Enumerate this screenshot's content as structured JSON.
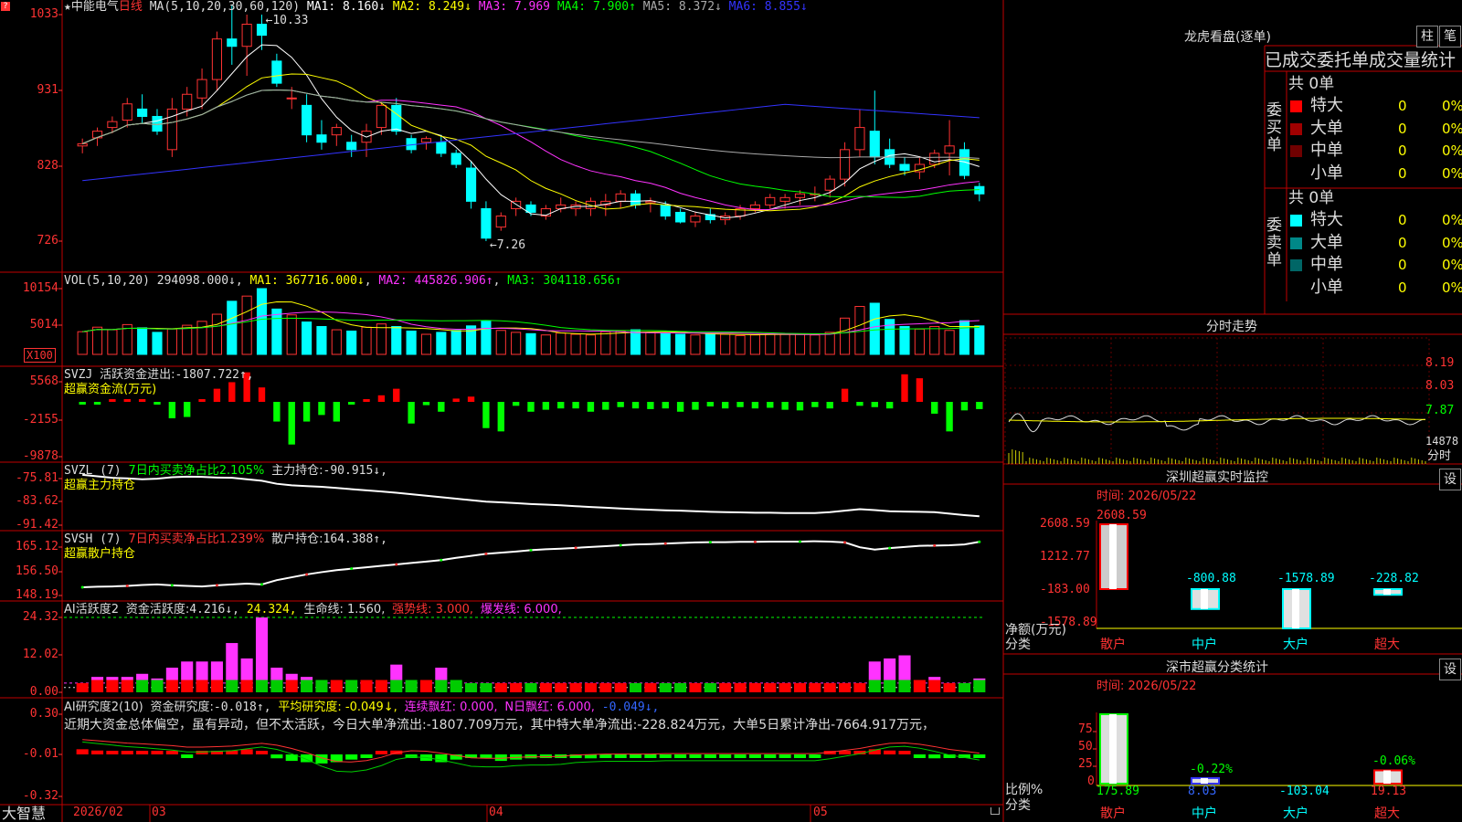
{
  "colors": {
    "up": "#ff3333",
    "down": "#00ffff",
    "grid": "#c00000",
    "axis": "#ff3333",
    "yellow": "#ffff00",
    "magenta": "#ff33ff",
    "green": "#00ff00",
    "blue": "#3333ff",
    "white": "#ffffff"
  },
  "icons": {
    "top_left": "question-icon",
    "star": "star-icon",
    "lock": "lock-icon"
  },
  "price_panel": {
    "star": "★",
    "stock_name": "中能电气",
    "period": "日线",
    "ma_params": "MA(5,10,20,30,60,120)",
    "ma": [
      {
        "label": "MA1:",
        "value": "8.160↓",
        "color": "#ffffff"
      },
      {
        "label": "MA2:",
        "value": "8.249↓",
        "color": "#ffff00"
      },
      {
        "label": "MA3:",
        "value": "7.969",
        "color": "#ff33ff"
      },
      {
        "label": "MA4:",
        "value": "7.900↑",
        "color": "#00ff00"
      },
      {
        "label": "MA5:",
        "value": "8.372↓",
        "color": "#aaaaaa"
      },
      {
        "label": "MA6:",
        "value": "8.855↓",
        "color": "#3333ff"
      }
    ],
    "yticks": [
      "1033",
      "931",
      "828",
      "726"
    ],
    "high_label": "←10.33",
    "low_label": "←7.26"
  },
  "vol_panel": {
    "title": "VOL(5,10,20)",
    "value": "294098.000↓",
    "ma1": "MA1: 367716.000↓",
    "ma2": "MA2: 445826.906↑",
    "ma3": "MA3: 304118.656↑",
    "yticks": [
      "10154",
      "5014"
    ],
    "unit": "X100"
  },
  "svzj_panel": {
    "title": "SVZJ",
    "label": "活跃资金进出:",
    "value": "-1807.722↑,",
    "sub": "超赢资金流(万元)",
    "yticks": [
      "5568",
      "-2155",
      "-9878"
    ]
  },
  "svzl_panel": {
    "title": "SVZL (7)",
    "ratio": "7日内买卖净占比2.105%",
    "label": "主力持仓:",
    "value": "-90.915↓,",
    "sub": "超赢主力持仓",
    "yticks": [
      "-75.81",
      "-83.62",
      "-91.42"
    ]
  },
  "svsh_panel": {
    "title": "SVSH (7)",
    "ratio": "7日内买卖净占比1.239%",
    "label": "散户持仓:",
    "value": "164.388↑,",
    "sub": "超赢散户持仓",
    "yticks": [
      "165.12",
      "156.50",
      "148.19"
    ]
  },
  "ai_act_panel": {
    "title": "AI活跃度2",
    "label": "资金活跃度:",
    "value": "4.216↓,",
    "v2": "24.324,",
    "life": "生命线: 1.560,",
    "strong": "强势线: 3.000,",
    "burst": "爆发线: 6.000,",
    "yticks": [
      "24.32",
      "12.02",
      "0.00"
    ]
  },
  "ai_res_panel": {
    "title": "AI研究度2(10)",
    "label": "资金研究度:",
    "value": "-0.018↑,",
    "avg": "平均研究度: -0.049↓,",
    "red": "连续飘红: 0.000,",
    "nred": "N日飘红: 6.000,",
    "tail": "-0.049↓,",
    "comment": "近期大资金总体偏空，虽有异动，但不太活跃，今日大单净流出:-1807.709万元，其中特大单净流出:-228.824万元，大单5日累计净出-7664.917万元，",
    "yticks": [
      "0.30",
      "-0.01",
      "-0.32"
    ]
  },
  "xaxis": {
    "labels": [
      "2026/02",
      "03",
      "04",
      "05"
    ],
    "brand": "大智慧"
  },
  "lhb": {
    "title": "龙虎看盘(逐单)",
    "btn1": "柱",
    "btn2": "笔",
    "subtitle": "已成交委托单成交量统计",
    "buy_label": "委买单",
    "sell_label": "委卖单",
    "buy_total": "共 0单",
    "sell_total": "共 0单",
    "buy_rows": [
      {
        "name": "特大",
        "count": "0",
        "pct": "0%",
        "color": "#ff0000"
      },
      {
        "name": "大单",
        "count": "0",
        "pct": "0%",
        "color": "#a00000"
      },
      {
        "name": "中单",
        "count": "0",
        "pct": "0%",
        "color": "#700000"
      },
      {
        "name": "小单",
        "count": "0",
        "pct": "0%",
        "color": ""
      }
    ],
    "sell_rows": [
      {
        "name": "特大",
        "count": "0",
        "pct": "0%",
        "color": "#00ffff"
      },
      {
        "name": "大单",
        "count": "0",
        "pct": "0%",
        "color": "#008888"
      },
      {
        "name": "中单",
        "count": "0",
        "pct": "0%",
        "color": "#006666"
      },
      {
        "name": "小单",
        "count": "0",
        "pct": "0%",
        "color": ""
      }
    ]
  },
  "intraday": {
    "title": "分时走势",
    "yticks": [
      "8.19",
      "8.03",
      "7.87",
      "14878"
    ],
    "xlabel": "分时"
  },
  "sz_monitor": {
    "title": "深圳超赢实时监控",
    "btn": "设",
    "time": "时间: 2026/05/22",
    "yticks": [
      "2608.59",
      "1212.77",
      "-183.00",
      "-1578.89"
    ],
    "ylabel": "净额(万元)",
    "xlabel": "分类",
    "bars": [
      {
        "cat": "散户",
        "value": 2608.59,
        "label": "2608.59"
      },
      {
        "cat": "中户",
        "value": -800.88,
        "label": "-800.88"
      },
      {
        "cat": "大户",
        "value": -1578.89,
        "label": "-1578.89"
      },
      {
        "cat": "超大",
        "value": -228.82,
        "label": "-228.82"
      }
    ]
  },
  "sz_class": {
    "title": "深市超赢分类统计",
    "btn": "设",
    "time": "时间: 2026/05/22",
    "yticks": [
      "75",
      "50",
      "25",
      "0"
    ],
    "ylabel": "比例%",
    "xlabel": "分类",
    "bars": [
      {
        "cat": "散户",
        "value": 175.89,
        "top": "",
        "bottom": "175.89"
      },
      {
        "cat": "中户",
        "value": 8.03,
        "top": "-0.22%",
        "bottom": "8.03"
      },
      {
        "cat": "大户",
        "value": -103.04,
        "top": "",
        "bottom": "-103.04"
      },
      {
        "cat": "超大",
        "value": 19.13,
        "top": "-0.06%",
        "bottom": "19.13"
      }
    ]
  },
  "chart_data": [
    {
      "type": "candlestick",
      "title": "中能电气 日线",
      "y_unit": "price x100",
      "ylim": [
        700,
        1050
      ],
      "candles": [
        {
          "o": 855,
          "h": 865,
          "l": 845,
          "c": 858
        },
        {
          "o": 866,
          "h": 880,
          "l": 855,
          "c": 875
        },
        {
          "o": 880,
          "h": 895,
          "l": 872,
          "c": 888
        },
        {
          "o": 890,
          "h": 920,
          "l": 880,
          "c": 912
        },
        {
          "o": 905,
          "h": 925,
          "l": 885,
          "c": 895
        },
        {
          "o": 895,
          "h": 905,
          "l": 870,
          "c": 875
        },
        {
          "o": 850,
          "h": 920,
          "l": 840,
          "c": 905
        },
        {
          "o": 905,
          "h": 935,
          "l": 895,
          "c": 925
        },
        {
          "o": 920,
          "h": 960,
          "l": 905,
          "c": 945
        },
        {
          "o": 945,
          "h": 1010,
          "l": 930,
          "c": 1000
        },
        {
          "o": 1000,
          "h": 1045,
          "l": 965,
          "c": 990
        },
        {
          "o": 990,
          "h": 1033,
          "l": 950,
          "c": 1020
        },
        {
          "o": 1020,
          "h": 1033,
          "l": 985,
          "c": 1005
        },
        {
          "o": 970,
          "h": 980,
          "l": 935,
          "c": 940
        },
        {
          "o": 920,
          "h": 935,
          "l": 905,
          "c": 920
        },
        {
          "o": 910,
          "h": 925,
          "l": 860,
          "c": 870
        },
        {
          "o": 870,
          "h": 890,
          "l": 850,
          "c": 860
        },
        {
          "o": 870,
          "h": 885,
          "l": 855,
          "c": 880
        },
        {
          "o": 860,
          "h": 870,
          "l": 840,
          "c": 850
        },
        {
          "o": 860,
          "h": 885,
          "l": 840,
          "c": 875
        },
        {
          "o": 880,
          "h": 915,
          "l": 870,
          "c": 910
        },
        {
          "o": 910,
          "h": 920,
          "l": 870,
          "c": 875
        },
        {
          "o": 865,
          "h": 870,
          "l": 845,
          "c": 850
        },
        {
          "o": 860,
          "h": 868,
          "l": 850,
          "c": 865
        },
        {
          "o": 860,
          "h": 870,
          "l": 840,
          "c": 845
        },
        {
          "o": 845,
          "h": 850,
          "l": 825,
          "c": 830
        },
        {
          "o": 825,
          "h": 835,
          "l": 770,
          "c": 780
        },
        {
          "o": 770,
          "h": 780,
          "l": 726,
          "c": 730
        },
        {
          "o": 745,
          "h": 765,
          "l": 740,
          "c": 760
        },
        {
          "o": 770,
          "h": 785,
          "l": 760,
          "c": 780
        },
        {
          "o": 775,
          "h": 780,
          "l": 760,
          "c": 765
        },
        {
          "o": 760,
          "h": 775,
          "l": 755,
          "c": 770
        },
        {
          "o": 770,
          "h": 785,
          "l": 765,
          "c": 775
        },
        {
          "o": 770,
          "h": 780,
          "l": 760,
          "c": 775
        },
        {
          "o": 770,
          "h": 785,
          "l": 760,
          "c": 780
        },
        {
          "o": 775,
          "h": 790,
          "l": 760,
          "c": 780
        },
        {
          "o": 780,
          "h": 795,
          "l": 770,
          "c": 790
        },
        {
          "o": 790,
          "h": 795,
          "l": 770,
          "c": 775
        },
        {
          "o": 778,
          "h": 785,
          "l": 765,
          "c": 780
        },
        {
          "o": 775,
          "h": 780,
          "l": 755,
          "c": 760
        },
        {
          "o": 765,
          "h": 770,
          "l": 750,
          "c": 752
        },
        {
          "o": 752,
          "h": 765,
          "l": 745,
          "c": 760
        },
        {
          "o": 762,
          "h": 770,
          "l": 750,
          "c": 755
        },
        {
          "o": 755,
          "h": 765,
          "l": 748,
          "c": 760
        },
        {
          "o": 760,
          "h": 775,
          "l": 755,
          "c": 770
        },
        {
          "o": 770,
          "h": 780,
          "l": 765,
          "c": 775
        },
        {
          "o": 775,
          "h": 790,
          "l": 770,
          "c": 785
        },
        {
          "o": 780,
          "h": 790,
          "l": 770,
          "c": 785
        },
        {
          "o": 785,
          "h": 795,
          "l": 775,
          "c": 790
        },
        {
          "o": 790,
          "h": 800,
          "l": 780,
          "c": 790
        },
        {
          "o": 795,
          "h": 815,
          "l": 785,
          "c": 810
        },
        {
          "o": 810,
          "h": 860,
          "l": 800,
          "c": 850
        },
        {
          "o": 850,
          "h": 905,
          "l": 840,
          "c": 880
        },
        {
          "o": 875,
          "h": 930,
          "l": 830,
          "c": 840
        },
        {
          "o": 850,
          "h": 865,
          "l": 825,
          "c": 830
        },
        {
          "o": 830,
          "h": 840,
          "l": 815,
          "c": 822
        },
        {
          "o": 820,
          "h": 840,
          "l": 810,
          "c": 830
        },
        {
          "o": 830,
          "h": 850,
          "l": 825,
          "c": 845
        },
        {
          "o": 845,
          "h": 890,
          "l": 815,
          "c": 855
        },
        {
          "o": 850,
          "h": 860,
          "l": 810,
          "c": 815
        },
        {
          "o": 800,
          "h": 805,
          "l": 780,
          "c": 790
        }
      ]
    },
    {
      "type": "bar",
      "title": "VOL(5,10,20)",
      "y_unit": "x100",
      "ylim": [
        0,
        11000
      ],
      "values": [
        3500,
        4200,
        3800,
        4600,
        4100,
        3400,
        3900,
        4500,
        5100,
        6200,
        8200,
        9000,
        10154,
        7000,
        6100,
        5000,
        4300,
        3800,
        3600,
        4200,
        4700,
        4300,
        3600,
        3100,
        3400,
        3700,
        4400,
        5200,
        3700,
        3400,
        3200,
        3000,
        3300,
        3100,
        3000,
        3500,
        3600,
        3800,
        3400,
        3200,
        3100,
        3000,
        3200,
        3100,
        2900,
        3000,
        3100,
        3200,
        3100,
        3000,
        3400,
        5600,
        7400,
        7900,
        5400,
        4300,
        3900,
        4300,
        3700,
        5200,
        4400
      ]
    },
    {
      "type": "bar",
      "title": "SVZJ 活跃资金进出",
      "y_unit": "万元",
      "ylim": [
        -9878,
        5568
      ],
      "values": [
        -300,
        -200,
        200,
        400,
        300,
        -100,
        -2500,
        -2300,
        100,
        2000,
        3000,
        4500,
        2200,
        -3000,
        -6500,
        -3000,
        -2000,
        -3000,
        -300,
        300,
        1000,
        2000,
        -3300,
        -500,
        -1500,
        500,
        800,
        -4000,
        -4500,
        -600,
        -1500,
        -1200,
        -1000,
        -1000,
        -1500,
        -1200,
        -800,
        -1000,
        -1100,
        -1000,
        -1500,
        -1200,
        -700,
        -1000,
        -800,
        -1000,
        -900,
        -1200,
        -1300,
        -800,
        -1000,
        2000,
        -600,
        -800,
        -1000,
        4200,
        3600,
        -1800,
        -4500,
        -1300,
        -1100,
        -1000,
        -1300,
        -3000,
        -2200,
        -1800
      ]
    },
    {
      "type": "line",
      "title": "SVZL 主力持仓",
      "ylim": [
        -92,
        -75
      ],
      "values": [
        -77,
        -77.5,
        -78,
        -78.2,
        -78.5,
        -78.3,
        -77.8,
        -77.6,
        -77.7,
        -77.9,
        -78,
        -78.5,
        -79,
        -80,
        -80.5,
        -80.8,
        -81,
        -81.4,
        -81.8,
        -82.2,
        -82.6,
        -83,
        -83.5,
        -84,
        -84.5,
        -85,
        -85.5,
        -86,
        -86.2,
        -86.5,
        -86.8,
        -87,
        -87.2,
        -87.5,
        -87.8,
        -88,
        -88.3,
        -88.5,
        -88.7,
        -88.9,
        -89,
        -89.2,
        -89.4,
        -89.5,
        -89.6,
        -89.7,
        -89.7,
        -89.8,
        -89.8,
        -89.8,
        -89.5,
        -89,
        -88.5,
        -88.8,
        -89.2,
        -89.3,
        -89.4,
        -89.5,
        -90,
        -90.5,
        -90.9
      ]
    },
    {
      "type": "line",
      "title": "SVSH 散户持仓",
      "ylim": [
        147,
        166
      ],
      "values": [
        148.5,
        148.7,
        148.8,
        149,
        149.3,
        149.5,
        149.2,
        149,
        148.8,
        149.2,
        149.5,
        149.8,
        149.5,
        151,
        152,
        153,
        153.8,
        154.5,
        155,
        155.5,
        156,
        156.5,
        157,
        157.5,
        158,
        158.8,
        159.5,
        160.2,
        160.6,
        161,
        161.5,
        161.8,
        162,
        162.3,
        162.6,
        162.9,
        163.2,
        163.5,
        163.6,
        163.8,
        164,
        164.2,
        164.3,
        164.3,
        164.4,
        164.4,
        164.5,
        164.5,
        164.5,
        164.6,
        164.5,
        164.2,
        162.5,
        161.7,
        162.2,
        162.6,
        163,
        163.1,
        163.2,
        163.5,
        164.4
      ]
    },
    {
      "type": "bar",
      "title": "AI活跃度2 资金活跃度",
      "ylim": [
        0,
        25
      ],
      "values": [
        3,
        5,
        5,
        5,
        6,
        4.5,
        8,
        10,
        10,
        10,
        16,
        11,
        24.3,
        8,
        6,
        5,
        4,
        4,
        4,
        4,
        4,
        9,
        4,
        4,
        8,
        4,
        3,
        3,
        3,
        3,
        3,
        3,
        3,
        3,
        3,
        3,
        3,
        3,
        3,
        3,
        3,
        3,
        3,
        3,
        3,
        3,
        3,
        3,
        3,
        3,
        3,
        3,
        3,
        10,
        11,
        12,
        4,
        5,
        3,
        3,
        4.5,
        8,
        4,
        3
      ]
    },
    {
      "type": "bar",
      "title": "AI研究度2(10) 资金研究度",
      "ylim": [
        -0.32,
        0.3
      ],
      "values": [
        0.04,
        0.03,
        0.02,
        0.01,
        0.01,
        0.02,
        0.01,
        -0.01,
        0.01,
        0.02,
        0.03,
        0.04,
        0.02,
        -0.03,
        -0.05,
        -0.06,
        -0.07,
        -0.06,
        -0.04,
        -0.02,
        0.01,
        0.03,
        -0.02,
        -0.05,
        -0.06,
        -0.04,
        -0.02,
        -0.03,
        -0.05,
        -0.04,
        -0.03,
        -0.02,
        -0.02,
        -0.02,
        -0.03,
        -0.02,
        -0.02,
        -0.02,
        -0.02,
        -0.02,
        -0.02,
        -0.02,
        -0.02,
        -0.02,
        -0.02,
        -0.02,
        -0.02,
        -0.02,
        -0.02,
        -0.02,
        0.01,
        0.02,
        0.02,
        0.04,
        0.03,
        0.02,
        -0.01,
        -0.03,
        -0.02,
        -0.01,
        -0.02,
        -0.01,
        -0.02
      ]
    }
  ]
}
